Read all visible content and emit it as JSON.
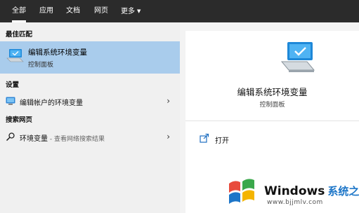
{
  "tabs": [
    {
      "label": "全部",
      "active": true
    },
    {
      "label": "应用"
    },
    {
      "label": "文档"
    },
    {
      "label": "网页"
    },
    {
      "label": "更多"
    }
  ],
  "sections": {
    "best_match": "最佳匹配",
    "settings": "设置",
    "web": "搜索网页"
  },
  "best_match": {
    "title": "编辑系统环境变量",
    "subtitle": "控制面板"
  },
  "settings_items": [
    {
      "label": "编辑帐户的环境变量"
    }
  ],
  "web_items": [
    {
      "label": "环境变量",
      "hint": " - 查看网络搜索结果"
    }
  ],
  "detail": {
    "title": "编辑系统环境变量",
    "subtitle": "控制面板",
    "actions": [
      {
        "label": "打开"
      }
    ]
  },
  "watermark": {
    "brand": "Windows",
    "brand_cn": "系统之家",
    "url": "www.bjjmlv.com"
  },
  "colors": {
    "topbar": "#2b2b2b",
    "selected": "#a9ccec",
    "watermark_blue": "#1d76c8"
  }
}
